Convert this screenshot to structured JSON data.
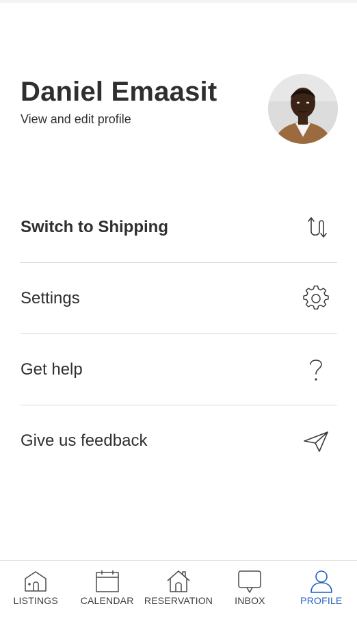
{
  "profile": {
    "name": "Daniel Emaasit",
    "subtitle": "View and edit profile"
  },
  "menu": {
    "items": [
      {
        "label": "Switch to Shipping",
        "icon": "switch-arrows-icon"
      },
      {
        "label": "Settings",
        "icon": "gear-icon"
      },
      {
        "label": "Get help",
        "icon": "question-icon"
      },
      {
        "label": "Give us feedback",
        "icon": "paper-plane-icon"
      }
    ]
  },
  "tabbar": {
    "tabs": [
      {
        "label": "LISTINGS",
        "icon": "listings-icon",
        "active": false
      },
      {
        "label": "CALENDAR",
        "icon": "calendar-icon",
        "active": false
      },
      {
        "label": "RESERVATION",
        "icon": "house-icon",
        "active": false
      },
      {
        "label": "INBOX",
        "icon": "chat-bubble-icon",
        "active": false
      },
      {
        "label": "PROFILE",
        "icon": "person-icon",
        "active": true
      }
    ]
  },
  "colors": {
    "active_tab": "#1f5fbf",
    "text": "#2f2f2f",
    "divider": "#d8d8d8"
  }
}
